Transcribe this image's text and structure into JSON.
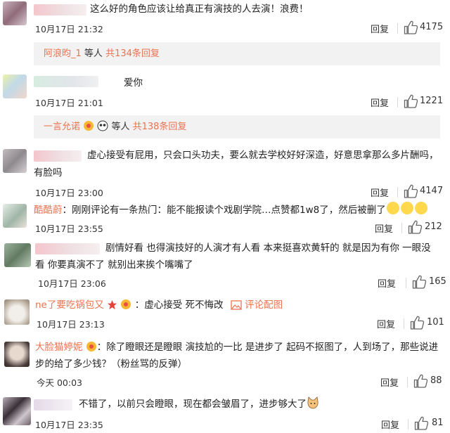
{
  "comments": [
    {
      "text": "这么好的角色应该让给真正有演技的人去演！浪费！",
      "time": "10月17日 21:32",
      "reply": "回复",
      "likes": "4175"
    },
    {
      "text": "爱你",
      "time": "10月17日 21:01",
      "reply": "回复",
      "likes": "1221"
    },
    {
      "text_line1": "虚心接受有屁用，只会口头功夫，要么就去学校好好深造，好意思拿那么多片酬吗，",
      "text_line2": "有脸吗",
      "time": "10月17日 23:00",
      "reply": "回复",
      "likes": "4147"
    },
    {
      "user": "酷酷蔚",
      "text": "：刚刚评论有一条热门：能不能报读个戏剧学院…点赞都1w8了，然后被删了",
      "time": "10月17日 23:55",
      "reply": "回复",
      "likes": "212"
    },
    {
      "text_line1": "剧情好看  也得演技好的人演才有人看  本来挺喜欢黄轩的  就是因为有你  一眼没",
      "text_line2": "看  你要真演不了  就别出来挨个嘴嘴了",
      "time": "10月17日 23:06",
      "reply": "回复",
      "likes": "165"
    },
    {
      "user": "ne了要吃锅包又",
      "text": "：虚心接受 死不悔改",
      "pic_label": "评论配图",
      "time": "10月17日 23:13",
      "reply": "回复",
      "likes": "101"
    },
    {
      "user": "大脸猫婷妮",
      "text_line1": "：除了瞪眼还是瞪眼 演技尬的一比 是进步了 起码不抠图了，人到场了，那些说进",
      "text_line2": "步的给了多少钱？（粉丝骂的反弹）",
      "time": "今天 00:03",
      "reply": "回复",
      "likes": "88"
    },
    {
      "text": "不错了，以前只会瞪眼，现在都会皱眉了，进步够大了",
      "time": "10月17日 23:35",
      "reply": "回复",
      "likes": "81"
    }
  ],
  "subreplies": [
    {
      "user": "阿浪昀_1",
      "suffix": "等人",
      "total": "共134条回复"
    },
    {
      "user": "一言允诺",
      "suffix": "等人",
      "total": "共138条回复"
    }
  ],
  "colors": {
    "accent": "#eb7350",
    "text": "#333333",
    "subreply_bg": "#f2f2f2",
    "separator": "#d9d9d9"
  }
}
